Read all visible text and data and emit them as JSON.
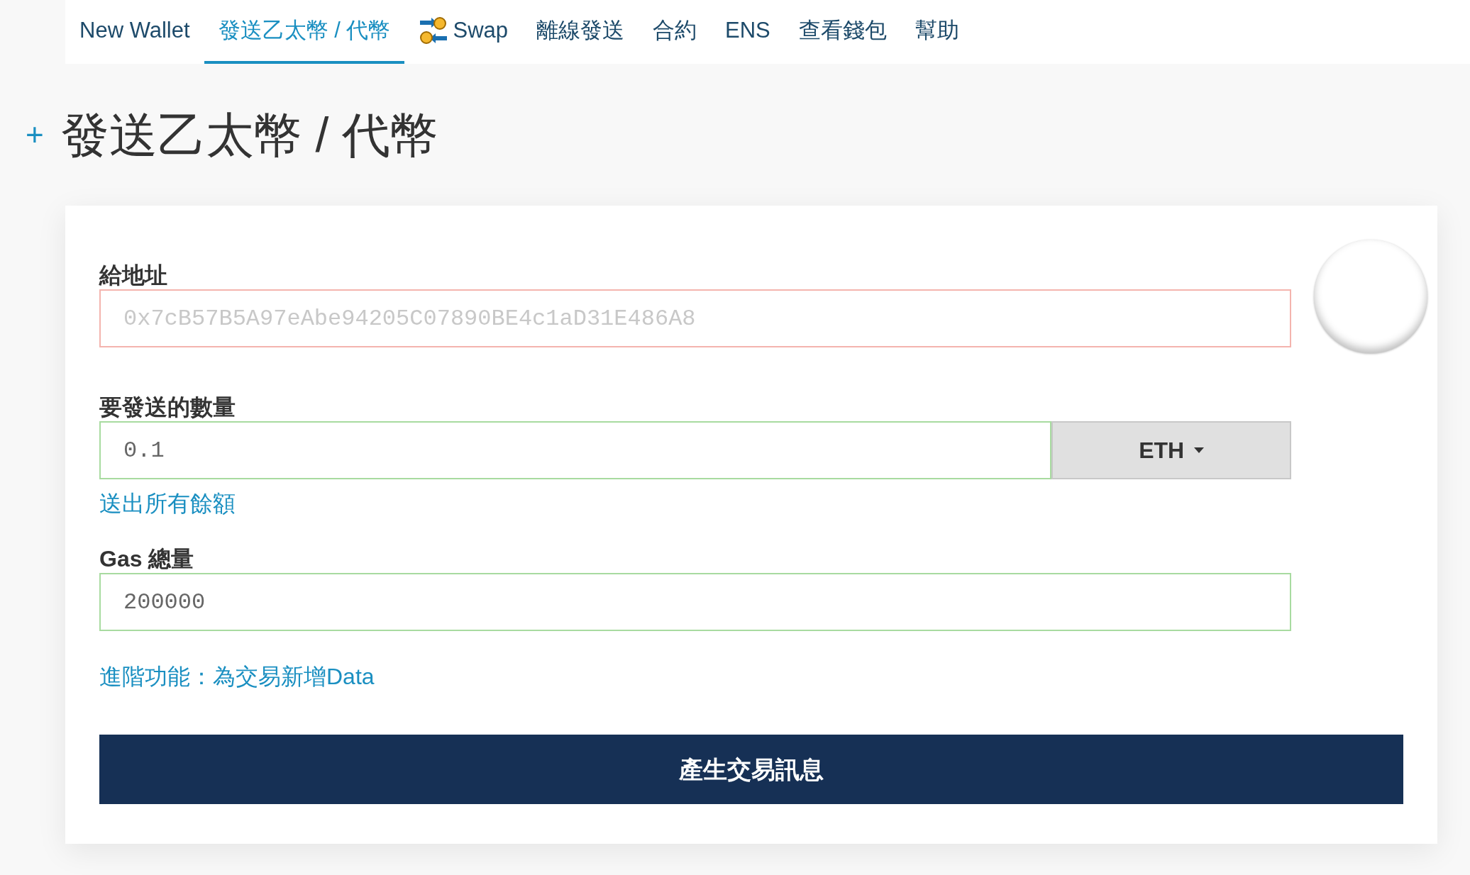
{
  "nav": [
    {
      "label": "New Wallet",
      "selected": false,
      "icon": false
    },
    {
      "label": "發送乙太幣 / 代幣",
      "selected": true,
      "icon": false
    },
    {
      "label": "Swap",
      "selected": false,
      "icon": true
    },
    {
      "label": "離線發送",
      "selected": false,
      "icon": false
    },
    {
      "label": "合約",
      "selected": false,
      "icon": false
    },
    {
      "label": "ENS",
      "selected": false,
      "icon": false
    },
    {
      "label": "查看錢包",
      "selected": false,
      "icon": false
    },
    {
      "label": "幫助",
      "selected": false,
      "icon": false
    }
  ],
  "page": {
    "expand_symbol": "+",
    "title": "發送乙太幣 / 代幣"
  },
  "form": {
    "to_address": {
      "label": "給地址",
      "placeholder": "0x7cB57B5A97eAbe94205C07890BE4c1aD31E486A8",
      "valid": false
    },
    "amount": {
      "label": "要發送的數量",
      "value": "0.1",
      "valid": true,
      "unit": "ETH",
      "send_all_link": "送出所有餘額"
    },
    "gas": {
      "label": "Gas 總量",
      "value": "200000",
      "valid": true
    },
    "advanced_link": "進階功能：為交易新增Data",
    "submit": "產生交易訊息"
  }
}
